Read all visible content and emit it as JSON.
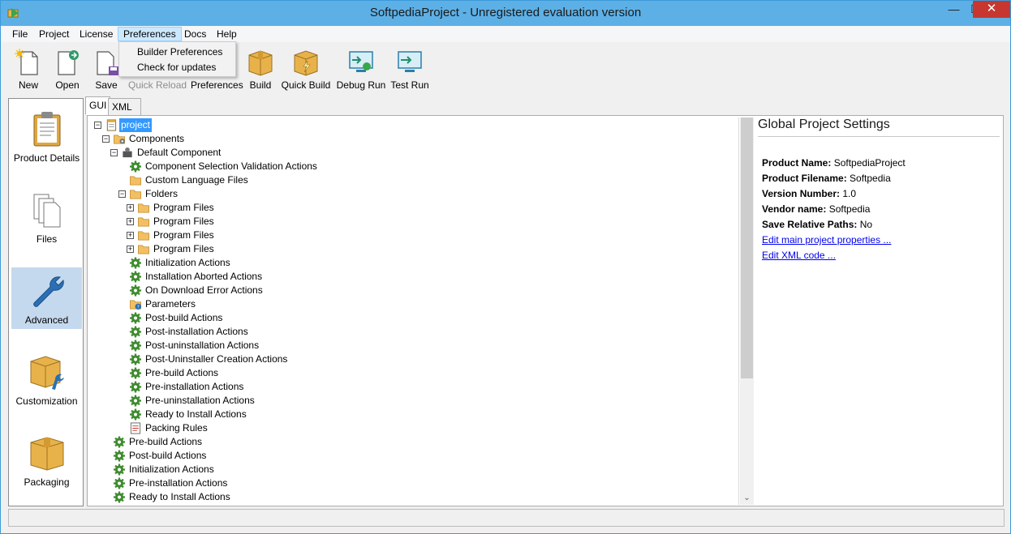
{
  "window": {
    "title": "SoftpediaProject - Unregistered evaluation version",
    "controls": {
      "minimize": "—",
      "maximize": "☐",
      "close": "✕"
    }
  },
  "menu": {
    "items": [
      "File",
      "Project",
      "License",
      "Preferences",
      "Docs",
      "Help"
    ],
    "active": "Preferences",
    "dropdown": [
      "Builder Preferences",
      "Check for updates"
    ]
  },
  "toolbar": {
    "items": [
      {
        "label": "New",
        "icon": "new-file-icon",
        "enabled": true
      },
      {
        "label": "Open",
        "icon": "open-file-icon",
        "enabled": true
      },
      {
        "label": "Save",
        "icon": "save-icon",
        "enabled": true
      },
      {
        "label": "Quick Reload",
        "icon": "reload-icon",
        "enabled": false
      },
      {
        "label": "Preferences",
        "icon": "preferences-icon",
        "enabled": true
      },
      {
        "label": "Build",
        "icon": "box-icon",
        "enabled": true
      },
      {
        "label": "Quick Build",
        "icon": "quick-box-icon",
        "enabled": true
      },
      {
        "label": "Debug Run",
        "icon": "debug-monitor-icon",
        "enabled": true
      },
      {
        "label": "Test Run",
        "icon": "test-monitor-icon",
        "enabled": true
      }
    ]
  },
  "sidebar": {
    "items": [
      {
        "label": "Product Details",
        "icon": "clipboard-icon"
      },
      {
        "label": "Files",
        "icon": "files-icon"
      },
      {
        "label": "Advanced",
        "icon": "wrench-icon"
      },
      {
        "label": "Customization",
        "icon": "box-wrench-icon"
      },
      {
        "label": "Packaging",
        "icon": "package-icon"
      }
    ],
    "active": "Advanced"
  },
  "tabs": {
    "items": [
      "GUI",
      "XML Editor"
    ],
    "active": "GUI"
  },
  "tree": {
    "rows": [
      {
        "label": "project",
        "icon": "project-icon",
        "depth": 0,
        "expander": "minus",
        "selected": true
      },
      {
        "label": "Components",
        "icon": "folder-gear-icon",
        "depth": 1,
        "expander": "minus"
      },
      {
        "label": "Default Component",
        "icon": "component-icon",
        "depth": 2,
        "expander": "minus"
      },
      {
        "label": "Component Selection Validation Actions",
        "icon": "gear-icon",
        "depth": 3
      },
      {
        "label": "Custom Language Files",
        "icon": "folder-icon",
        "depth": 3
      },
      {
        "label": "Folders",
        "icon": "folder-icon",
        "depth": 3,
        "expander": "minus"
      },
      {
        "label": "Program Files",
        "icon": "folder-icon",
        "depth": 4,
        "expander": "plus"
      },
      {
        "label": "Program Files",
        "icon": "folder-icon",
        "depth": 4,
        "expander": "plus"
      },
      {
        "label": "Program Files",
        "icon": "folder-icon",
        "depth": 4,
        "expander": "plus"
      },
      {
        "label": "Program Files",
        "icon": "folder-icon",
        "depth": 4,
        "expander": "plus"
      },
      {
        "label": "Initialization Actions",
        "icon": "gear-icon",
        "depth": 3
      },
      {
        "label": "Installation Aborted Actions",
        "icon": "gear-icon",
        "depth": 3
      },
      {
        "label": "On Download Error Actions",
        "icon": "gear-icon",
        "depth": 3
      },
      {
        "label": "Parameters",
        "icon": "folder-question-icon",
        "depth": 3
      },
      {
        "label": "Post-build Actions",
        "icon": "gear-icon",
        "depth": 3
      },
      {
        "label": "Post-installation Actions",
        "icon": "gear-icon",
        "depth": 3
      },
      {
        "label": "Post-uninstallation Actions",
        "icon": "gear-icon",
        "depth": 3
      },
      {
        "label": "Post-Uninstaller Creation Actions",
        "icon": "gear-icon",
        "depth": 3
      },
      {
        "label": "Pre-build Actions",
        "icon": "gear-icon",
        "depth": 3
      },
      {
        "label": "Pre-installation Actions",
        "icon": "gear-icon",
        "depth": 3
      },
      {
        "label": "Pre-uninstallation Actions",
        "icon": "gear-icon",
        "depth": 3
      },
      {
        "label": "Ready to Install Actions",
        "icon": "gear-icon",
        "depth": 3
      },
      {
        "label": "Packing Rules",
        "icon": "rules-icon",
        "depth": 3
      },
      {
        "label": "Pre-build Actions",
        "icon": "gear-icon",
        "depth": 1
      },
      {
        "label": "Post-build Actions",
        "icon": "gear-icon",
        "depth": 1
      },
      {
        "label": "Initialization Actions",
        "icon": "gear-icon",
        "depth": 1
      },
      {
        "label": "Pre-installation Actions",
        "icon": "gear-icon",
        "depth": 1
      },
      {
        "label": "Ready to Install Actions",
        "icon": "gear-icon",
        "depth": 1
      }
    ]
  },
  "settings": {
    "title": "Global Project Settings",
    "properties": [
      {
        "key": "Product Name:",
        "value": "SoftpediaProject"
      },
      {
        "key": "Product Filename:",
        "value": "Softpedia"
      },
      {
        "key": "Version Number:",
        "value": "1.0"
      },
      {
        "key": "Vendor name:",
        "value": "Softpedia"
      },
      {
        "key": "Save Relative Paths:",
        "value": "No"
      }
    ],
    "links": [
      "Edit main project properties ...",
      "Edit XML code ..."
    ]
  },
  "colors": {
    "titlebar": "#5db0e6",
    "close": "#c7372f",
    "selection": "#3399ff",
    "nav_active": "#c5d9ee",
    "link": "#0000ee",
    "folder": "#f2c062",
    "gear": "#3f8b2f"
  }
}
